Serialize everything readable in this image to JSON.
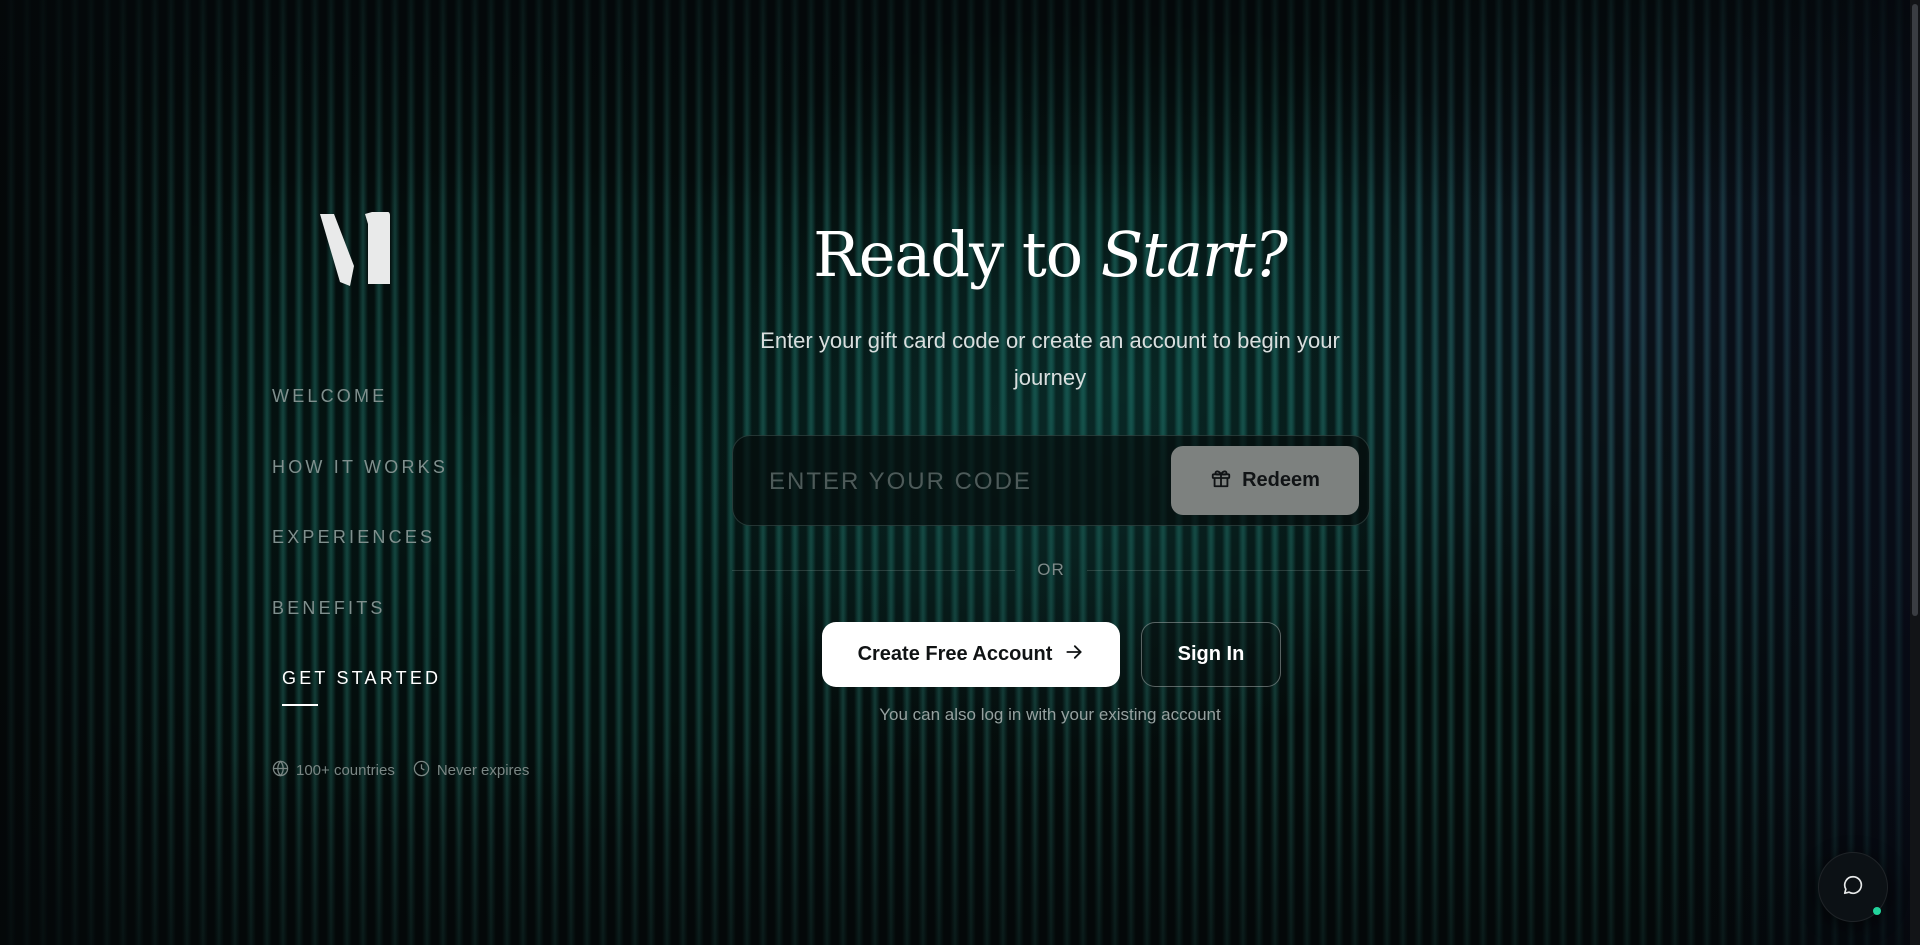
{
  "brand": {
    "logo_icon": "logo-mark"
  },
  "nav": {
    "items": [
      {
        "label": "WELCOME"
      },
      {
        "label": "HOW IT WORKS"
      },
      {
        "label": "EXPERIENCES"
      },
      {
        "label": "BENEFITS"
      },
      {
        "label": "GET STARTED"
      }
    ],
    "active_index": 4
  },
  "meta": {
    "countries": {
      "icon": "globe-icon",
      "text": "100+ countries"
    },
    "expiry": {
      "icon": "clock-icon",
      "text": "Never expires"
    }
  },
  "hero": {
    "title_plain": "Ready to ",
    "title_emphasis": "Start?",
    "subtitle": "Enter your gift card code or create an account to begin your journey"
  },
  "code_form": {
    "placeholder": "ENTER YOUR CODE",
    "value": "",
    "redeem_label": "Redeem",
    "redeem_icon": "gift-icon"
  },
  "divider": {
    "label": "OR"
  },
  "actions": {
    "create_label": "Create Free Account",
    "create_icon": "arrow-right-icon",
    "signin_label": "Sign In",
    "hint": "You can also log in with your existing account"
  },
  "chat": {
    "icon": "chat-bubble-icon",
    "status_color": "#22d39b"
  },
  "colors": {
    "accent_teal": "#0f5a52",
    "button_white": "#ffffff",
    "redeem_gray": "#7d817f"
  }
}
